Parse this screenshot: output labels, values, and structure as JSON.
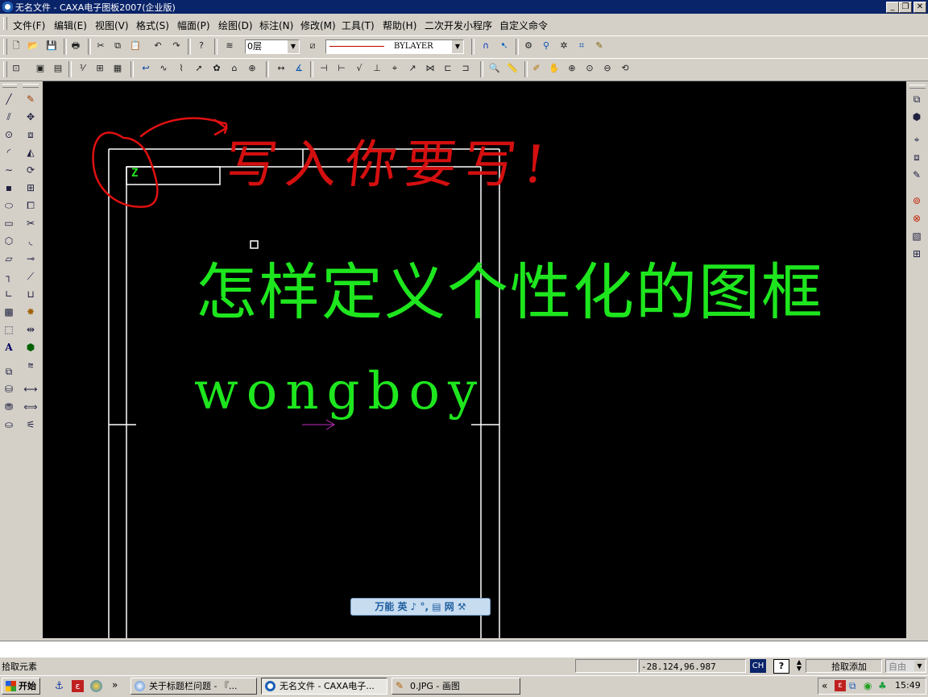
{
  "window": {
    "title": "无名文件 - CAXA电子图板2007(企业版)",
    "min": "_",
    "max": "❐",
    "close": "✕"
  },
  "menu": [
    "文件(F)",
    "编辑(E)",
    "视图(V)",
    "格式(S)",
    "幅面(P)",
    "绘图(D)",
    "标注(N)",
    "修改(M)",
    "工具(T)",
    "帮助(H)",
    "二次开发小程序",
    "自定义命令"
  ],
  "toolbar": {
    "layer_value": "0层",
    "linetype_value": "BYLAYER"
  },
  "drawing": {
    "heading": "怎样定义个性化的图框",
    "author": "wongboy",
    "handwritten_note": "写入你要写!",
    "frame_label": "Z",
    "ime_bar": "万能 英 ♪ °, ▤ 网 ⚒"
  },
  "colors": {
    "title_bar": "#0a246a",
    "canvas": "#000000",
    "drawing_text": "#1ee61e",
    "annotation": "#e01010",
    "frame_lines": "#ffffff"
  },
  "status": {
    "prompt": "拾取元素",
    "coordinates": "-28.124,96.987",
    "ch_badge": "CH",
    "mode": "拾取添加",
    "snap": "自由"
  },
  "taskbar": {
    "start": "开始",
    "overflow": "»",
    "tasks": [
      {
        "label": "关于标题栏问题 - 『...",
        "active": false
      },
      {
        "label": "无名文件 - CAXA电子...",
        "active": true
      },
      {
        "label": "0.JPG - 画图",
        "active": false
      }
    ],
    "tray_expand": "«",
    "clock": "15:49"
  }
}
